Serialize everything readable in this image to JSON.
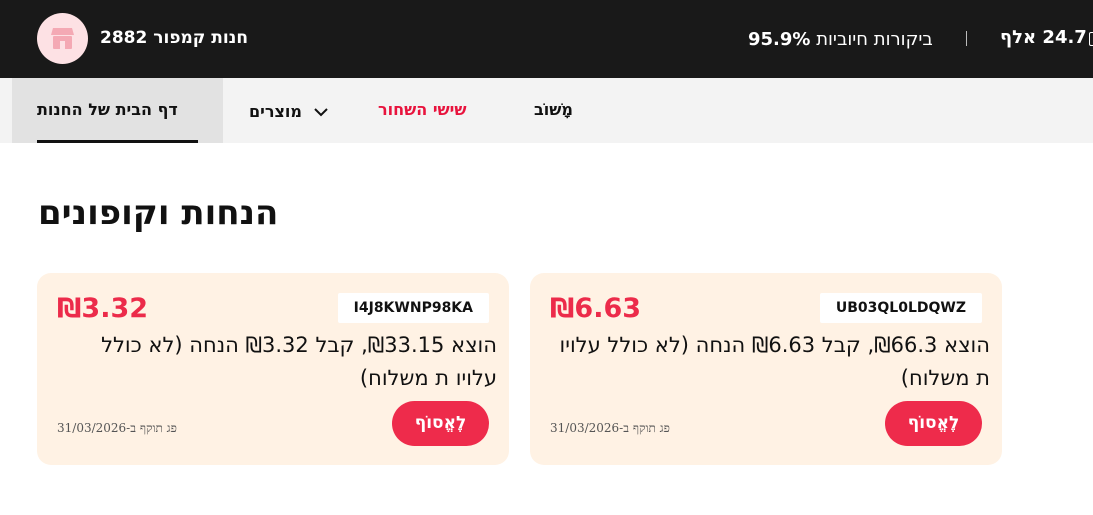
{
  "header": {
    "store_name": "חנות קמפור 2882",
    "reviews_prefix": "ביקורות חיוביות",
    "reviews_pct": "95.9%",
    "followers": "24.7 אלף",
    "avatar_icon": "store-icon",
    "colors": {
      "background": "#191919",
      "avatar_bg": "#fde1e4",
      "avatar_fg": "#f4a9b4"
    }
  },
  "nav": {
    "home": "דף הבית של החנות",
    "products": "מוצרים",
    "products_icon": "chevron-down-icon",
    "deals": "שישי השחור",
    "feedback": "מָשׁוֹב",
    "colors": {
      "deals": "#e8133d",
      "bar": "#f3f3f3",
      "active_bg": "#e2e2e2"
    }
  },
  "section": {
    "title": "הנחות וקופונים"
  },
  "coupons": [
    {
      "amount": "₪3.32",
      "code": "I4J8KWNP98KA",
      "description": "הוצא ₪33.15, קבל ₪3.32 הנחה (לא כולל עלויו ת משלוח)",
      "expiry": "פג תוקף ב-31/03/2026",
      "collect": "לֶאֱסוֹף"
    },
    {
      "amount": "₪6.63",
      "code": "UB03QL0LDQWZ",
      "description": "הוצא ₪66.3, קבל ₪6.63 הנחה (לא כולל עלויו ת משלוח)",
      "expiry": "פג תוקף ב-31/03/2026",
      "collect": "לֶאֱסוֹף"
    }
  ],
  "theme": {
    "coupon_bg": "#fff2e4",
    "accent": "#ec2b4a"
  }
}
